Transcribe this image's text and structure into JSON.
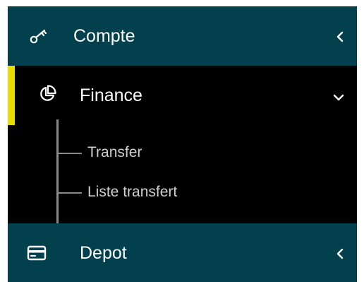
{
  "menu": {
    "items": [
      {
        "label": "Compte",
        "icon": "key-icon",
        "expanded": false,
        "active": false
      },
      {
        "label": "Finance",
        "icon": "pie-chart-icon",
        "expanded": true,
        "active": true,
        "children": [
          {
            "label": "Transfer"
          },
          {
            "label": "Liste transfert"
          }
        ]
      },
      {
        "label": "Depot",
        "icon": "credit-card-icon",
        "expanded": false,
        "active": false
      }
    ]
  },
  "colors": {
    "header_bg": "#02404d",
    "active_bg": "#000000",
    "accent": "#e8dd00",
    "text": "#ffffff",
    "subtext": "#cfcfcf",
    "tree_line": "#8a8a8a"
  }
}
